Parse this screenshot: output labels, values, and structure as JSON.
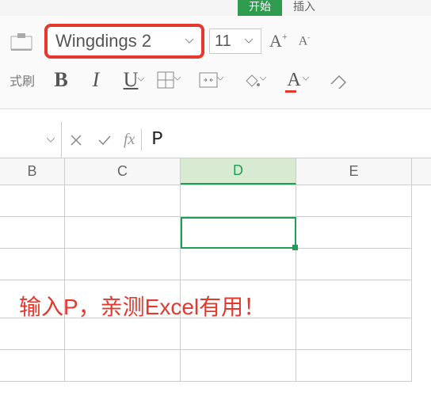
{
  "tabs": {
    "active": "开始",
    "next": "插入"
  },
  "font": {
    "name": "Wingdings 2",
    "size": "11",
    "format_painter_label": "式刷",
    "bold": "B",
    "italic": "I",
    "underline": "U",
    "font_a": "A",
    "grow": "A",
    "shrink": "A"
  },
  "formula": {
    "fx": "fx",
    "value": "P"
  },
  "columns": [
    "B",
    "C",
    "D",
    "E"
  ],
  "active_cell": {
    "col": "D",
    "display": "✓"
  },
  "annotation": "输入P，亲测Excel有用！"
}
